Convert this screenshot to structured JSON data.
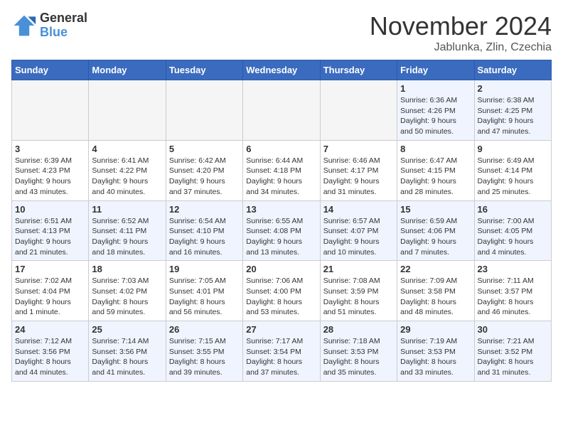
{
  "logo": {
    "general": "General",
    "blue": "Blue"
  },
  "title": {
    "month": "November 2024",
    "location": "Jablunka, Zlin, Czechia"
  },
  "headers": [
    "Sunday",
    "Monday",
    "Tuesday",
    "Wednesday",
    "Thursday",
    "Friday",
    "Saturday"
  ],
  "weeks": [
    [
      {
        "day": "",
        "info": ""
      },
      {
        "day": "",
        "info": ""
      },
      {
        "day": "",
        "info": ""
      },
      {
        "day": "",
        "info": ""
      },
      {
        "day": "",
        "info": ""
      },
      {
        "day": "1",
        "info": "Sunrise: 6:36 AM\nSunset: 4:26 PM\nDaylight: 9 hours\nand 50 minutes."
      },
      {
        "day": "2",
        "info": "Sunrise: 6:38 AM\nSunset: 4:25 PM\nDaylight: 9 hours\nand 47 minutes."
      }
    ],
    [
      {
        "day": "3",
        "info": "Sunrise: 6:39 AM\nSunset: 4:23 PM\nDaylight: 9 hours\nand 43 minutes."
      },
      {
        "day": "4",
        "info": "Sunrise: 6:41 AM\nSunset: 4:22 PM\nDaylight: 9 hours\nand 40 minutes."
      },
      {
        "day": "5",
        "info": "Sunrise: 6:42 AM\nSunset: 4:20 PM\nDaylight: 9 hours\nand 37 minutes."
      },
      {
        "day": "6",
        "info": "Sunrise: 6:44 AM\nSunset: 4:18 PM\nDaylight: 9 hours\nand 34 minutes."
      },
      {
        "day": "7",
        "info": "Sunrise: 6:46 AM\nSunset: 4:17 PM\nDaylight: 9 hours\nand 31 minutes."
      },
      {
        "day": "8",
        "info": "Sunrise: 6:47 AM\nSunset: 4:15 PM\nDaylight: 9 hours\nand 28 minutes."
      },
      {
        "day": "9",
        "info": "Sunrise: 6:49 AM\nSunset: 4:14 PM\nDaylight: 9 hours\nand 25 minutes."
      }
    ],
    [
      {
        "day": "10",
        "info": "Sunrise: 6:51 AM\nSunset: 4:13 PM\nDaylight: 9 hours\nand 21 minutes."
      },
      {
        "day": "11",
        "info": "Sunrise: 6:52 AM\nSunset: 4:11 PM\nDaylight: 9 hours\nand 18 minutes."
      },
      {
        "day": "12",
        "info": "Sunrise: 6:54 AM\nSunset: 4:10 PM\nDaylight: 9 hours\nand 16 minutes."
      },
      {
        "day": "13",
        "info": "Sunrise: 6:55 AM\nSunset: 4:08 PM\nDaylight: 9 hours\nand 13 minutes."
      },
      {
        "day": "14",
        "info": "Sunrise: 6:57 AM\nSunset: 4:07 PM\nDaylight: 9 hours\nand 10 minutes."
      },
      {
        "day": "15",
        "info": "Sunrise: 6:59 AM\nSunset: 4:06 PM\nDaylight: 9 hours\nand 7 minutes."
      },
      {
        "day": "16",
        "info": "Sunrise: 7:00 AM\nSunset: 4:05 PM\nDaylight: 9 hours\nand 4 minutes."
      }
    ],
    [
      {
        "day": "17",
        "info": "Sunrise: 7:02 AM\nSunset: 4:04 PM\nDaylight: 9 hours\nand 1 minute."
      },
      {
        "day": "18",
        "info": "Sunrise: 7:03 AM\nSunset: 4:02 PM\nDaylight: 8 hours\nand 59 minutes."
      },
      {
        "day": "19",
        "info": "Sunrise: 7:05 AM\nSunset: 4:01 PM\nDaylight: 8 hours\nand 56 minutes."
      },
      {
        "day": "20",
        "info": "Sunrise: 7:06 AM\nSunset: 4:00 PM\nDaylight: 8 hours\nand 53 minutes."
      },
      {
        "day": "21",
        "info": "Sunrise: 7:08 AM\nSunset: 3:59 PM\nDaylight: 8 hours\nand 51 minutes."
      },
      {
        "day": "22",
        "info": "Sunrise: 7:09 AM\nSunset: 3:58 PM\nDaylight: 8 hours\nand 48 minutes."
      },
      {
        "day": "23",
        "info": "Sunrise: 7:11 AM\nSunset: 3:57 PM\nDaylight: 8 hours\nand 46 minutes."
      }
    ],
    [
      {
        "day": "24",
        "info": "Sunrise: 7:12 AM\nSunset: 3:56 PM\nDaylight: 8 hours\nand 44 minutes."
      },
      {
        "day": "25",
        "info": "Sunrise: 7:14 AM\nSunset: 3:56 PM\nDaylight: 8 hours\nand 41 minutes."
      },
      {
        "day": "26",
        "info": "Sunrise: 7:15 AM\nSunset: 3:55 PM\nDaylight: 8 hours\nand 39 minutes."
      },
      {
        "day": "27",
        "info": "Sunrise: 7:17 AM\nSunset: 3:54 PM\nDaylight: 8 hours\nand 37 minutes."
      },
      {
        "day": "28",
        "info": "Sunrise: 7:18 AM\nSunset: 3:53 PM\nDaylight: 8 hours\nand 35 minutes."
      },
      {
        "day": "29",
        "info": "Sunrise: 7:19 AM\nSunset: 3:53 PM\nDaylight: 8 hours\nand 33 minutes."
      },
      {
        "day": "30",
        "info": "Sunrise: 7:21 AM\nSunset: 3:52 PM\nDaylight: 8 hours\nand 31 minutes."
      }
    ]
  ]
}
